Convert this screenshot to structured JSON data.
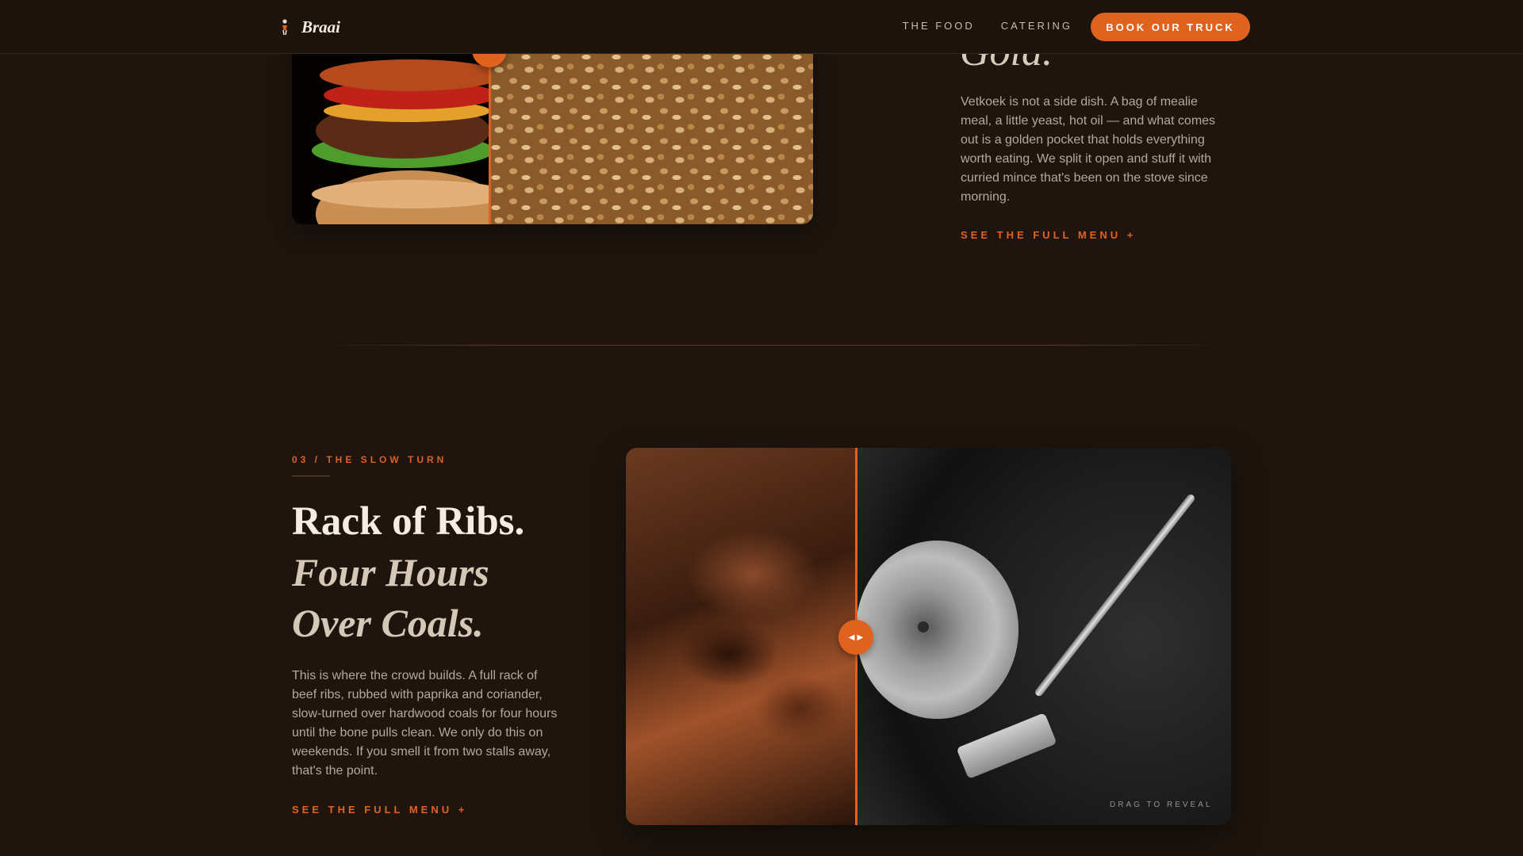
{
  "header": {
    "brand": "Braai",
    "nav": [
      "THE FOOD",
      "CATERING"
    ],
    "cta": "BOOK OUR TRUCK"
  },
  "section_prev": {
    "heading_fragment": "Gold.",
    "body": "Vetkoek is not a side dish. A bag of mealie meal, a little yeast, hot oil — and what comes out is a golden pocket that holds everything worth eating. We split it open and stuff it with curried mince that's been on the stove since morning.",
    "link": "SEE THE FULL MENU +",
    "compare": {
      "split_fraction": 0.38
    }
  },
  "section_ribs": {
    "eyebrow": "03 / THE SLOW TURN",
    "title_line1": "Rack of Ribs.",
    "title_line2": "Four Hours",
    "title_line3": "Over Coals.",
    "body": "This is where the crowd builds. A full rack of beef ribs, rubbed with paprika and coriander, slow-turned over hardwood coals for four hours until the bone pulls clean. We only do this on weekends. If you smell it from two stalls away, that's the point.",
    "link": "SEE THE FULL MENU +",
    "compare": {
      "label": "DRAG TO REVEAL",
      "split_fraction": 0.38
    }
  },
  "icons": {
    "logo": "flame-person-icon",
    "handle": "left-right-arrows-icon"
  },
  "colors": {
    "background": "#1f150e",
    "accent": "#e0621f",
    "text_light": "#f5ede2",
    "text_muted": "#b6a899"
  }
}
